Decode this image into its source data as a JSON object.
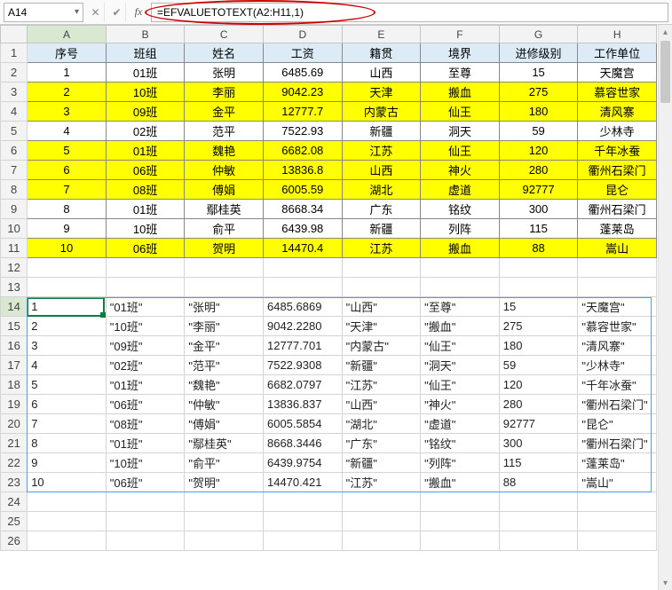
{
  "namebox": "A14",
  "formula": "=EFVALUETOTEXT(A2:H11,1)",
  "columns": [
    "A",
    "B",
    "C",
    "D",
    "E",
    "F",
    "G",
    "H"
  ],
  "header_row": [
    "序号",
    "班组",
    "姓名",
    "工资",
    "籍贯",
    "境界",
    "进修级别",
    "工作单位"
  ],
  "data_rows": [
    {
      "y": false,
      "cells": [
        "1",
        "01班",
        "张明",
        "6485.69",
        "山西",
        "至尊",
        "15",
        "天魔宫"
      ]
    },
    {
      "y": true,
      "cells": [
        "2",
        "10班",
        "李丽",
        "9042.23",
        "天津",
        "搬血",
        "275",
        "慕容世家"
      ]
    },
    {
      "y": true,
      "cells": [
        "3",
        "09班",
        "金平",
        "12777.7",
        "内蒙古",
        "仙王",
        "180",
        "清风寨"
      ]
    },
    {
      "y": false,
      "cells": [
        "4",
        "02班",
        "范平",
        "7522.93",
        "新疆",
        "洞天",
        "59",
        "少林寺"
      ]
    },
    {
      "y": true,
      "cells": [
        "5",
        "01班",
        "魏艳",
        "6682.08",
        "江苏",
        "仙王",
        "120",
        "千年冰蚕"
      ]
    },
    {
      "y": true,
      "cells": [
        "6",
        "06班",
        "仲敏",
        "13836.8",
        "山西",
        "神火",
        "280",
        "衢州石梁门"
      ]
    },
    {
      "y": true,
      "cells": [
        "7",
        "08班",
        "傅娟",
        "6005.59",
        "湖北",
        "虚道",
        "92777",
        "昆仑"
      ]
    },
    {
      "y": false,
      "cells": [
        "8",
        "01班",
        "鄢桂英",
        "8668.34",
        "广东",
        "铭纹",
        "300",
        "衢州石梁门"
      ]
    },
    {
      "y": false,
      "cells": [
        "9",
        "10班",
        "俞平",
        "6439.98",
        "新疆",
        "列阵",
        "115",
        "蓬莱岛"
      ]
    },
    {
      "y": true,
      "cells": [
        "10",
        "06班",
        "贺明",
        "14470.4",
        "江苏",
        "搬血",
        "88",
        "嵩山"
      ]
    }
  ],
  "text_rows": [
    [
      "1",
      "\"01班\"",
      "\"张明\"",
      "6485.6869",
      "\"山西\"",
      "\"至尊\"",
      "15",
      "\"天魔宫\""
    ],
    [
      "2",
      "\"10班\"",
      "\"李丽\"",
      "9042.2280",
      "\"天津\"",
      "\"搬血\"",
      "275",
      "\"慕容世家\""
    ],
    [
      "3",
      "\"09班\"",
      "\"金平\"",
      "12777.701",
      "\"内蒙古\"",
      "\"仙王\"",
      "180",
      "\"清风寨\""
    ],
    [
      "4",
      "\"02班\"",
      "\"范平\"",
      "7522.9308",
      "\"新疆\"",
      "\"洞天\"",
      "59",
      "\"少林寺\""
    ],
    [
      "5",
      "\"01班\"",
      "\"魏艳\"",
      "6682.0797",
      "\"江苏\"",
      "\"仙王\"",
      "120",
      "\"千年冰蚕\""
    ],
    [
      "6",
      "\"06班\"",
      "\"仲敏\"",
      "13836.837",
      "\"山西\"",
      "\"神火\"",
      "280",
      "\"衢州石梁门\""
    ],
    [
      "7",
      "\"08班\"",
      "\"傅娟\"",
      "6005.5854",
      "\"湖北\"",
      "\"虚道\"",
      "92777",
      "\"昆仑\""
    ],
    [
      "8",
      "\"01班\"",
      "\"鄢桂英\"",
      "8668.3446",
      "\"广东\"",
      "\"铭纹\"",
      "300",
      "\"衢州石梁门\""
    ],
    [
      "9",
      "\"10班\"",
      "\"俞平\"",
      "6439.9754",
      "\"新疆\"",
      "\"列阵\"",
      "115",
      "\"蓬莱岛\""
    ],
    [
      "10",
      "\"06班\"",
      "\"贺明\"",
      "14470.421",
      "\"江苏\"",
      "\"搬血\"",
      "88",
      "\"嵩山\""
    ]
  ],
  "row_labels_main": [
    "1",
    "2",
    "3",
    "4",
    "5",
    "6",
    "7",
    "8",
    "9",
    "10",
    "11",
    "12",
    "13"
  ],
  "row_labels_text": [
    "14",
    "15",
    "16",
    "17",
    "18",
    "19",
    "20",
    "21",
    "22",
    "23"
  ],
  "row_labels_tail": [
    "24",
    "25",
    "26"
  ]
}
